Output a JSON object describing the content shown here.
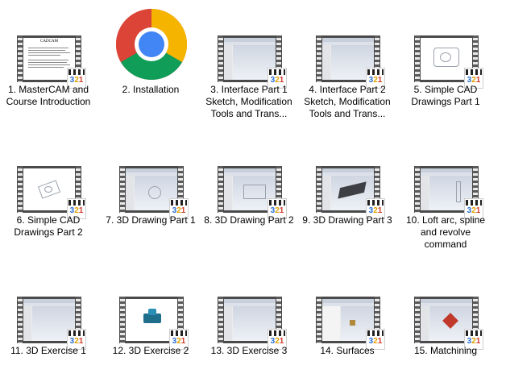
{
  "items": [
    {
      "label": "1. MasterCAM and Course Introduction",
      "badge": "321",
      "thumb_title": "CADCAM"
    },
    {
      "label": "2. Installation"
    },
    {
      "label": "3. Interface Part 1 Sketch, Modification Tools and Trans...",
      "badge": "321"
    },
    {
      "label": "4. Interface Part 2 Sketch, Modification Tools and Trans...",
      "badge": "321"
    },
    {
      "label": "5. Simple CAD Drawings Part 1",
      "badge": "321"
    },
    {
      "label": "6. Simple CAD Drawings Part 2",
      "badge": "321"
    },
    {
      "label": "7. 3D Drawing Part 1",
      "badge": "321"
    },
    {
      "label": "8. 3D Drawing Part 2",
      "badge": "321"
    },
    {
      "label": "9. 3D Drawing Part 3",
      "badge": "321"
    },
    {
      "label": "10. Loft arc, spline and revolve command",
      "badge": "321"
    },
    {
      "label": "11. 3D Exercise 1",
      "badge": "321"
    },
    {
      "label": "12. 3D Exercise 2",
      "badge": "321"
    },
    {
      "label": "13. 3D Exercise 3",
      "badge": "321"
    },
    {
      "label": "14. Surfaces",
      "badge": "321"
    },
    {
      "label": "15. Matchining",
      "badge": "321"
    }
  ],
  "colors": {
    "chrome_red": "#db4437",
    "chrome_yellow": "#f4b400",
    "chrome_green": "#0f9d58",
    "chrome_blue": "#4285f4",
    "badge_1": "#2a6fd6",
    "badge_2": "#e0a100",
    "badge_3": "#d63b2a"
  },
  "icons": [
    "video-file-icon",
    "chrome-icon",
    "media-player-badge-icon"
  ]
}
